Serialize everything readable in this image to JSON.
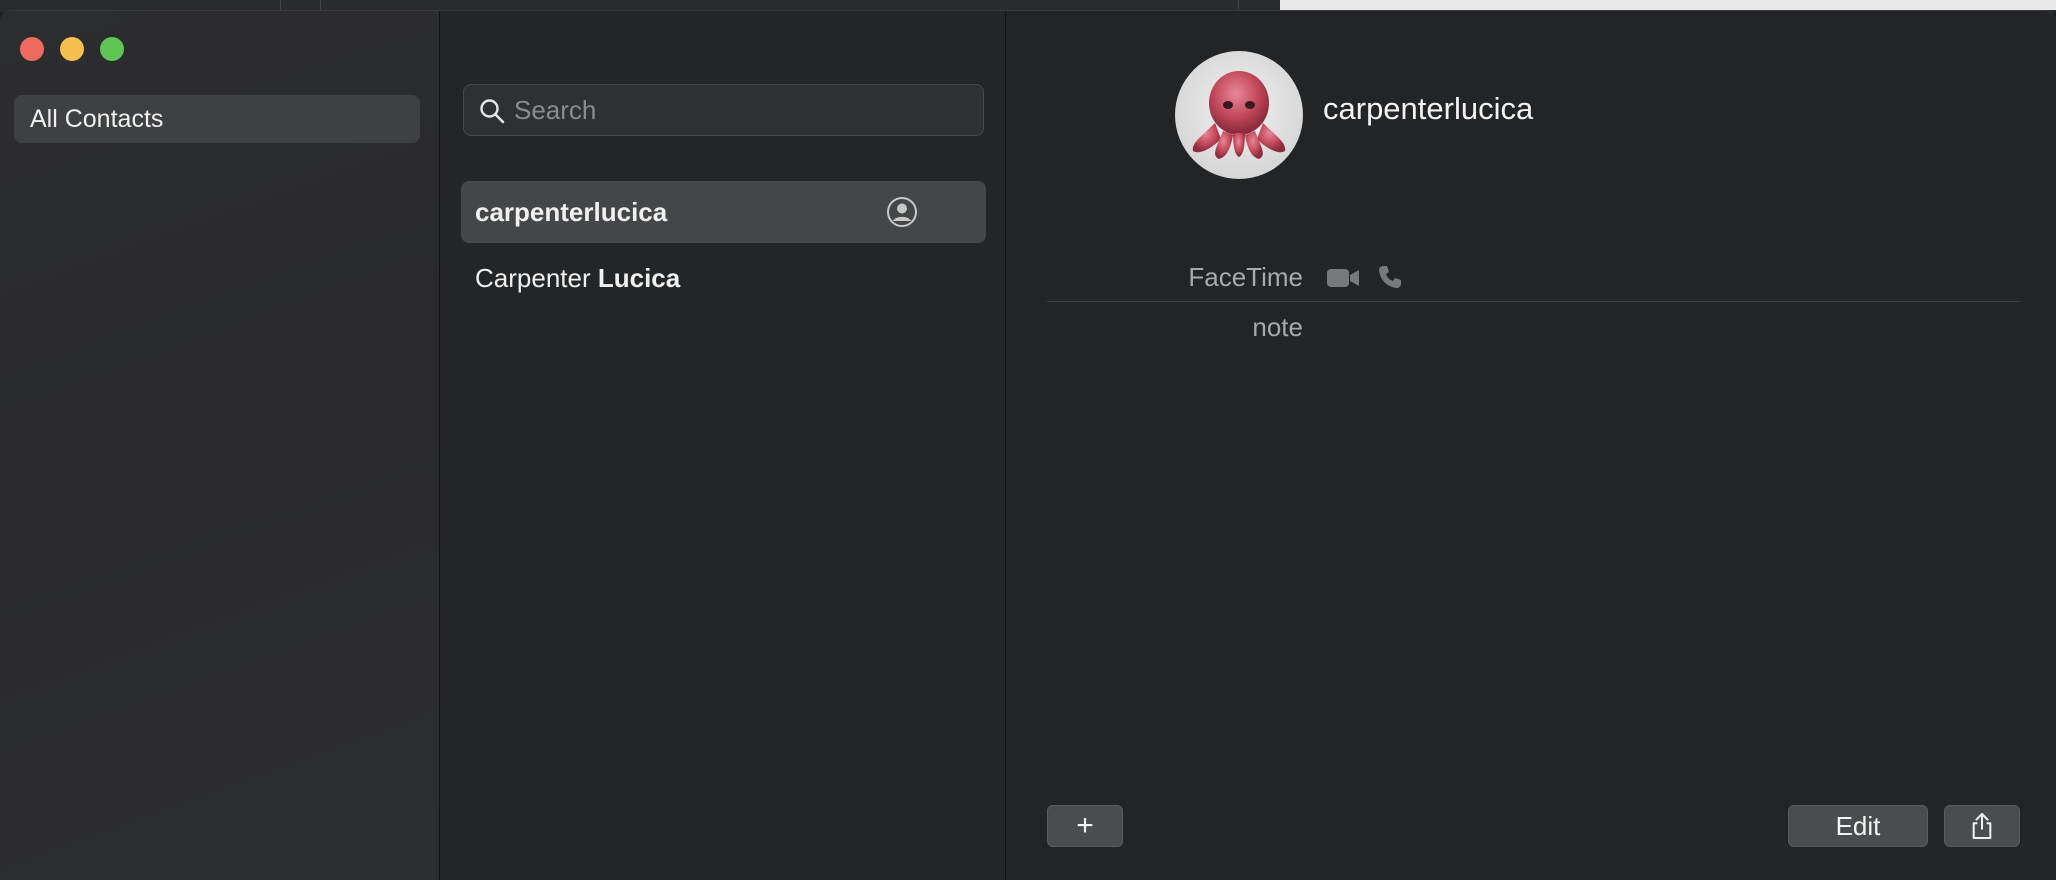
{
  "sidebar": {
    "items": [
      {
        "label": "All Contacts"
      }
    ]
  },
  "search": {
    "placeholder": "Search",
    "value": ""
  },
  "contacts": [
    {
      "name": "carpenterlucica",
      "selected": true,
      "is_me": true
    },
    {
      "name_first": "Carpenter ",
      "name_last": "Lucica",
      "selected": false
    }
  ],
  "detail": {
    "name": "carpenterlucica",
    "avatar_icon": "octopus-memoji",
    "fields": [
      {
        "label": "FaceTime",
        "icons": [
          "video-icon",
          "phone-icon"
        ]
      },
      {
        "label": "note"
      }
    ]
  },
  "toolbar": {
    "add_label": "+",
    "edit_label": "Edit",
    "share_icon": "share-icon"
  },
  "colors": {
    "close": "#ed6a5e",
    "minimize": "#f5bf4f",
    "maximize": "#61c554",
    "selected_row": "#444648",
    "avatar": "#c44a5c"
  }
}
